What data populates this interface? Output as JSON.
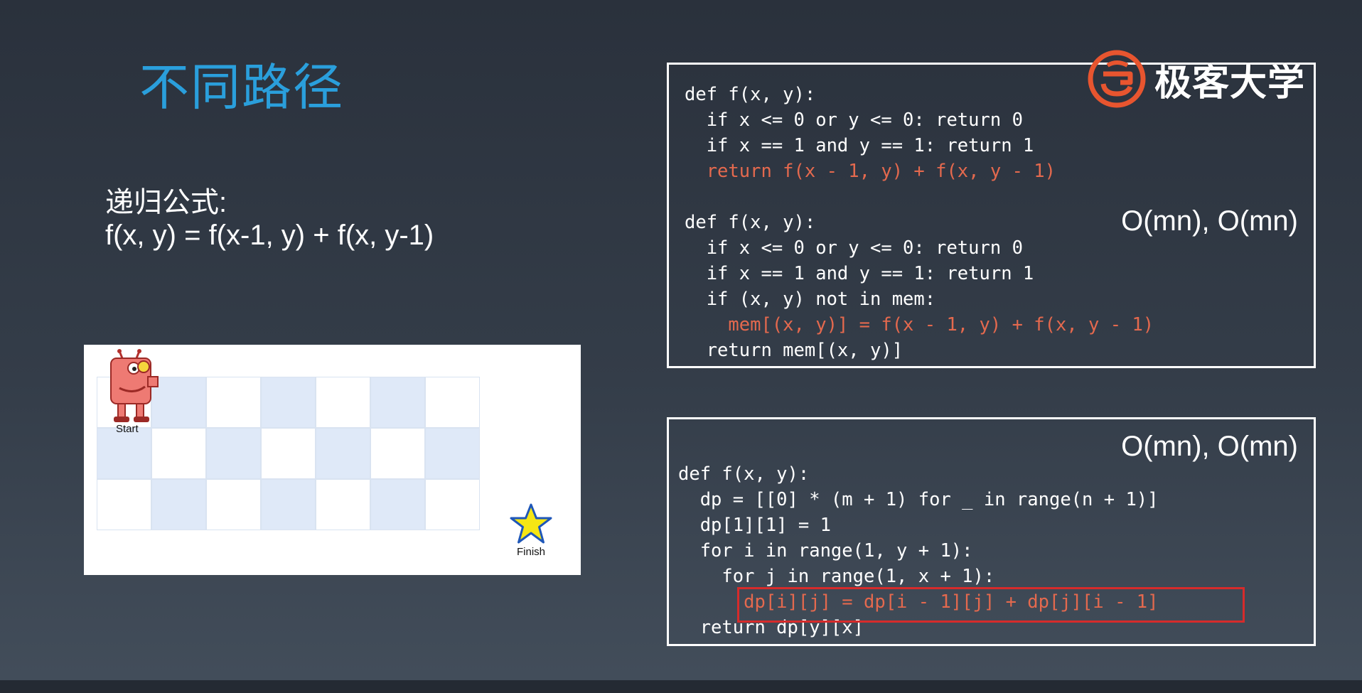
{
  "slide": {
    "title": "不同路径",
    "formula_label": "递归公式:",
    "formula": "f(x, y) = f(x-1, y) + f(x, y-1)"
  },
  "logo": {
    "text": "极客大学",
    "mark_icon": "geekbang-logo-icon",
    "brand_color": "#e8552f"
  },
  "grid_figure": {
    "rows": 3,
    "cols": 7,
    "start_label": "Start",
    "finish_label": "Finish",
    "start_icon": "robot-icon",
    "finish_icon": "star-icon"
  },
  "code_top": {
    "complexity": "O(mn), O(mn)",
    "lines": [
      {
        "text": "def f(x, y):",
        "color": "#ffffff"
      },
      {
        "text": "  if x <= 0 or y <= 0: return 0",
        "color": "#ffffff"
      },
      {
        "text": "  if x == 1 and y == 1: return 1",
        "color": "#ffffff"
      },
      {
        "text": "  return f(x - 1, y) + f(x, y - 1)",
        "color": "#e4694e"
      },
      {
        "text": "",
        "color": "#ffffff"
      },
      {
        "text": "def f(x, y):",
        "color": "#ffffff"
      },
      {
        "text": "  if x <= 0 or y <= 0: return 0",
        "color": "#ffffff"
      },
      {
        "text": "  if x == 1 and y == 1: return 1",
        "color": "#ffffff"
      },
      {
        "text": "  if (x, y) not in mem:",
        "color": "#ffffff"
      },
      {
        "text": "    mem[(x, y)] = f(x - 1, y) + f(x, y - 1)",
        "color": "#e4694e"
      },
      {
        "text": "  return mem[(x, y)]",
        "color": "#ffffff"
      }
    ]
  },
  "code_bottom": {
    "complexity": "O(mn), O(mn)",
    "lines": [
      {
        "text": "def f(x, y):",
        "color": "#ffffff"
      },
      {
        "text": "  dp = [[0] * (m + 1) for _ in range(n + 1)]",
        "color": "#ffffff"
      },
      {
        "text": "  dp[1][1] = 1",
        "color": "#ffffff"
      },
      {
        "text": "  for i in range(1, y + 1):",
        "color": "#ffffff"
      },
      {
        "text": "    for j in range(1, x + 1):",
        "color": "#ffffff"
      },
      {
        "text": "      dp[i][j] = dp[i - 1][j] + dp[j][i - 1]",
        "color": "#e4694e"
      },
      {
        "text": "  return dp[y][x]",
        "color": "#ffffff"
      }
    ],
    "highlight_color": "#d62b2b"
  }
}
